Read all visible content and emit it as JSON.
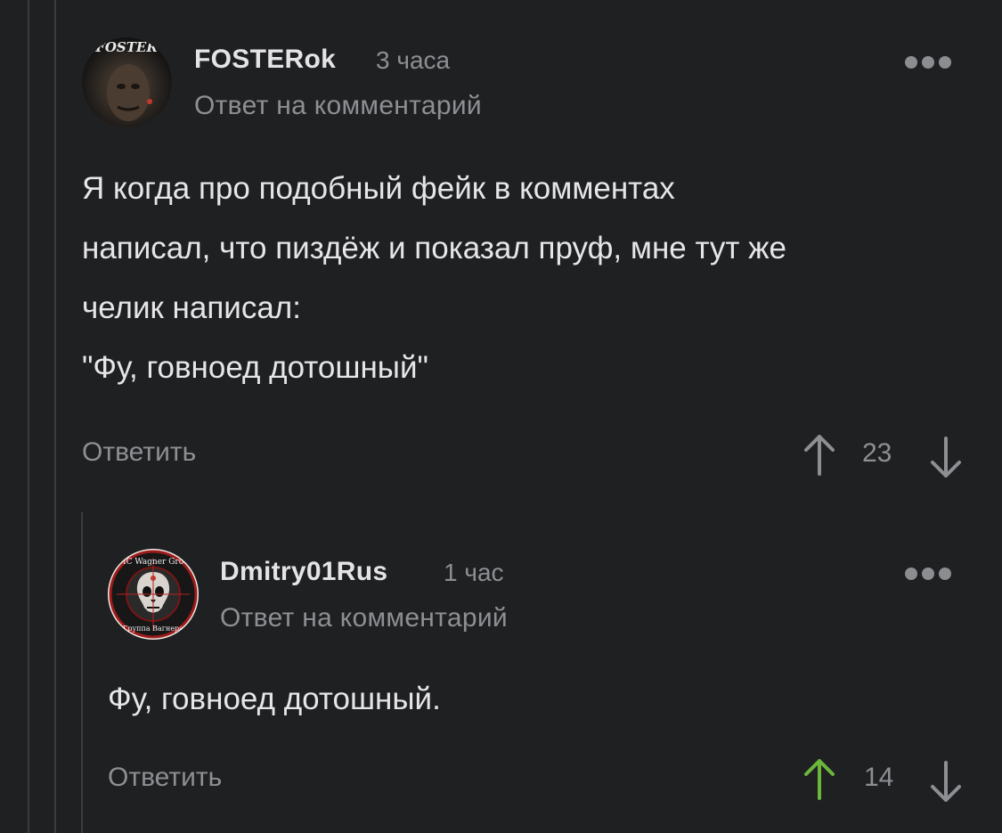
{
  "comments": [
    {
      "author": "FOSTERok",
      "avatar_text": "FOSTER",
      "time": "3 часа",
      "reply_note": "Ответ на комментарий",
      "text": "Я когда про подобный фейк в комментах\nнаписал, что пиздёж и показал пруф, мне тут же\nчелик написал:\n\"Фу, говноед дотошный\"",
      "reply_label": "Ответить",
      "score": "23",
      "upvoted": false
    },
    {
      "author": "Dmitry01Rus",
      "avatar_top_text": "PMC Wagner Group",
      "avatar_bottom_text": "Группа Вагнера",
      "time": "1 час",
      "reply_note": "Ответ на комментарий",
      "text": "Фу, говноед дотошный.",
      "reply_label": "Ответить",
      "score": "14",
      "upvoted": true
    }
  ],
  "colors": {
    "background": "#1f2022",
    "upvote_active": "#6cb63a",
    "muted": "#8e8f93"
  }
}
